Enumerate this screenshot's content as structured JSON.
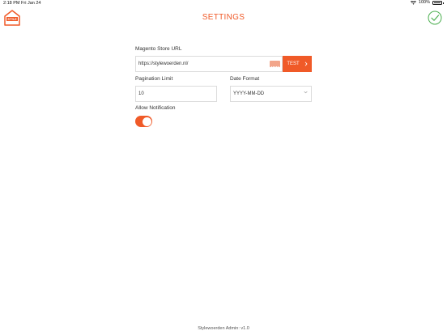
{
  "status_bar": {
    "time": "2:18 PM",
    "date": "Fri Jan 24",
    "wifi_icon": "wifi-icon",
    "battery_percent": "100%"
  },
  "header": {
    "logo_text": "STYLE",
    "title": "SETTINGS",
    "confirm_icon": "check-circle-icon"
  },
  "form": {
    "store_url": {
      "label": "Magento Store URL",
      "value": "https://stylewoerden.nl/",
      "keyboard_icon": "keyboard-icon",
      "test_label": "TEST",
      "test_icon": "chevron-right-icon"
    },
    "pagination": {
      "label": "Pagination Limit",
      "value": "10"
    },
    "date_format": {
      "label": "Date Format",
      "value": "YYYY-MM-DD",
      "icon": "chevron-down-icon"
    },
    "notification": {
      "label": "Allow Notification",
      "enabled": true
    }
  },
  "footer": {
    "version_text": "Stylewoerden Admin: v1.0"
  },
  "colors": {
    "accent": "#f05a28",
    "check": "#4caf50"
  }
}
